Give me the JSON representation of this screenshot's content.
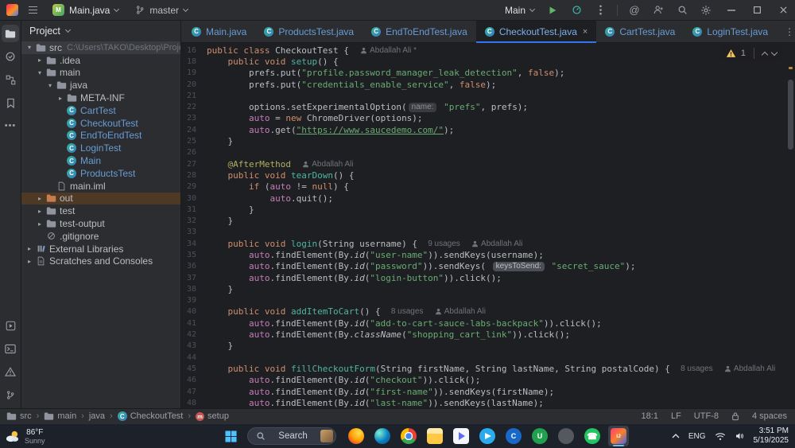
{
  "colors": {
    "accent_blue": "#3574f0",
    "keyword_orange": "#cf8e6d",
    "string_green": "#6aab73",
    "method_teal": "#4fb6a2",
    "field_purple": "#c77dbb",
    "annotation_yellow": "#b3ae60",
    "modified_blue": "#6a9cd4",
    "warning_yellow": "#f2c55c",
    "excluded_bg": "#4e3a24",
    "selection_bg": "#393b40"
  },
  "titlebar": {
    "project": "Main.java",
    "branch": "master",
    "run_config": "Main"
  },
  "project_panel": {
    "title": "Project",
    "tree": [
      {
        "label": "src",
        "path": "C:\\Users\\TAKO\\Desktop\\Project\\Pro...",
        "indent": 0,
        "chevron": "down",
        "icon": "folder",
        "state": "selected"
      },
      {
        "label": ".idea",
        "indent": 1,
        "chevron": "right",
        "icon": "folder"
      },
      {
        "label": "main",
        "indent": 1,
        "chevron": "down",
        "icon": "folder"
      },
      {
        "label": "java",
        "indent": 2,
        "chevron": "down",
        "icon": "folder"
      },
      {
        "label": "META-INF",
        "indent": 3,
        "chevron": "right",
        "icon": "folder"
      },
      {
        "label": "CartTest",
        "indent": 3,
        "icon": "class",
        "modified": true
      },
      {
        "label": "CheckoutTest",
        "indent": 3,
        "icon": "class",
        "modified": true
      },
      {
        "label": "EndToEndTest",
        "indent": 3,
        "icon": "class",
        "modified": true
      },
      {
        "label": "LoginTest",
        "indent": 3,
        "icon": "class",
        "modified": true
      },
      {
        "label": "Main",
        "indent": 3,
        "icon": "class",
        "modified": true
      },
      {
        "label": "ProductsTest",
        "indent": 3,
        "icon": "class",
        "modified": true
      },
      {
        "label": "main.iml",
        "indent": 2,
        "icon": "file"
      },
      {
        "label": "out",
        "indent": 1,
        "chevron": "right",
        "icon": "folder-excluded",
        "state": "excluded"
      },
      {
        "label": "test",
        "indent": 1,
        "chevron": "right",
        "icon": "folder"
      },
      {
        "label": "test-output",
        "indent": 1,
        "chevron": "right",
        "icon": "folder"
      },
      {
        "label": ".gitignore",
        "indent": 1,
        "icon": "ignored"
      },
      {
        "label": "External Libraries",
        "indent": 0,
        "chevron": "right",
        "icon": "library"
      },
      {
        "label": "Scratches and Consoles",
        "indent": 0,
        "chevron": "right",
        "icon": "scratch"
      }
    ]
  },
  "tabs": [
    {
      "label": "Main.java"
    },
    {
      "label": "ProductsTest.java"
    },
    {
      "label": "EndToEndTest.java"
    },
    {
      "label": "CheckoutTest.java",
      "active": true
    },
    {
      "label": "CartTest.java"
    },
    {
      "label": "LoginTest.java"
    }
  ],
  "editor": {
    "inspection": {
      "warning_count": "1"
    },
    "lines": [
      {
        "n": "16",
        "t": [
          [
            "public",
            "k"
          ],
          [
            " ",
            "d"
          ],
          [
            "class",
            "k"
          ],
          [
            " CheckoutTest {  ",
            "d"
          ],
          [
            "Abdallah Ali *",
            "au"
          ]
        ]
      },
      {
        "n": "18",
        "t": [
          [
            "    ",
            "d"
          ],
          [
            "public",
            "k"
          ],
          [
            " ",
            "d"
          ],
          [
            "void",
            "k"
          ],
          [
            " ",
            "d"
          ],
          [
            "setup",
            "f"
          ],
          [
            "() {",
            "d"
          ]
        ]
      },
      {
        "n": "19",
        "t": [
          [
            "        prefs.put(",
            "d"
          ],
          [
            "\"profile.password_manager_leak_detection\"",
            "s"
          ],
          [
            ", ",
            "d"
          ],
          [
            "false",
            "k"
          ],
          [
            ");",
            "d"
          ]
        ]
      },
      {
        "n": "20",
        "t": [
          [
            "        prefs.put(",
            "d"
          ],
          [
            "\"credentials_enable_service\"",
            "s"
          ],
          [
            ", ",
            "d"
          ],
          [
            "false",
            "k"
          ],
          [
            ");",
            "d"
          ]
        ]
      },
      {
        "n": "21",
        "t": []
      },
      {
        "n": "22",
        "t": [
          [
            "        options.setExperimentalOption(",
            "d"
          ],
          [
            "name:",
            "chip"
          ],
          [
            " ",
            "d"
          ],
          [
            "\"prefs\"",
            "s"
          ],
          [
            ", prefs);",
            "d"
          ]
        ]
      },
      {
        "n": "23",
        "t": [
          [
            "        ",
            "d"
          ],
          [
            "auto",
            "fd"
          ],
          [
            " = ",
            "d"
          ],
          [
            "new",
            "k"
          ],
          [
            " ChromeDriver(options);",
            "d"
          ]
        ]
      },
      {
        "n": "24",
        "t": [
          [
            "        ",
            "d"
          ],
          [
            "auto",
            "fd"
          ],
          [
            ".get(",
            "d"
          ],
          [
            "\"https://www.saucedemo.com/\"",
            "su"
          ],
          [
            ");",
            "d"
          ]
        ]
      },
      {
        "n": "25",
        "t": [
          [
            "    }",
            "d"
          ]
        ]
      },
      {
        "n": "26",
        "t": []
      },
      {
        "n": "27",
        "t": [
          [
            "    ",
            "d"
          ],
          [
            "@AfterMethod",
            "a"
          ],
          [
            "  ",
            "d"
          ],
          [
            "Abdallah Ali",
            "au"
          ]
        ]
      },
      {
        "n": "28",
        "t": [
          [
            "    ",
            "d"
          ],
          [
            "public",
            "k"
          ],
          [
            " ",
            "d"
          ],
          [
            "void",
            "k"
          ],
          [
            " ",
            "d"
          ],
          [
            "tearDown",
            "f"
          ],
          [
            "() {",
            "d"
          ]
        ]
      },
      {
        "n": "29",
        "t": [
          [
            "        ",
            "d"
          ],
          [
            "if",
            "k"
          ],
          [
            " (",
            "d"
          ],
          [
            "auto",
            "fd"
          ],
          [
            " != ",
            "d"
          ],
          [
            "null",
            "k"
          ],
          [
            ") {",
            "d"
          ]
        ]
      },
      {
        "n": "30",
        "t": [
          [
            "            ",
            "d"
          ],
          [
            "auto",
            "fd"
          ],
          [
            ".quit();",
            "d"
          ]
        ]
      },
      {
        "n": "31",
        "t": [
          [
            "        }",
            "d"
          ]
        ]
      },
      {
        "n": "32",
        "t": [
          [
            "    }",
            "d"
          ]
        ]
      },
      {
        "n": "33",
        "t": []
      },
      {
        "n": "34",
        "t": [
          [
            "    ",
            "d"
          ],
          [
            "public",
            "k"
          ],
          [
            " ",
            "d"
          ],
          [
            "void",
            "k"
          ],
          [
            " ",
            "d"
          ],
          [
            "login",
            "f"
          ],
          [
            "(String username) {  ",
            "d"
          ],
          [
            "9 usages",
            "m"
          ],
          [
            "  ",
            "d"
          ],
          [
            "Abdallah Ali",
            "au"
          ]
        ]
      },
      {
        "n": "35",
        "t": [
          [
            "        ",
            "d"
          ],
          [
            "auto",
            "fd"
          ],
          [
            ".findElement(By.",
            "d"
          ],
          [
            "id",
            "it"
          ],
          [
            "(",
            "d"
          ],
          [
            "\"user-name\"",
            "s"
          ],
          [
            ")).sendKeys(username);",
            "d"
          ]
        ]
      },
      {
        "n": "36",
        "t": [
          [
            "        ",
            "d"
          ],
          [
            "auto",
            "fd"
          ],
          [
            ".findElement(By.",
            "d"
          ],
          [
            "id",
            "it"
          ],
          [
            "(",
            "d"
          ],
          [
            "\"password\"",
            "s"
          ],
          [
            ")).sendKeys( ",
            "d"
          ],
          [
            "keysToSend:",
            "chip2"
          ],
          [
            " ",
            "d"
          ],
          [
            "\"secret_sauce\"",
            "s"
          ],
          [
            ");",
            "d"
          ]
        ]
      },
      {
        "n": "37",
        "t": [
          [
            "        ",
            "d"
          ],
          [
            "auto",
            "fd"
          ],
          [
            ".findElement(By.",
            "d"
          ],
          [
            "id",
            "it"
          ],
          [
            "(",
            "d"
          ],
          [
            "\"login-button\"",
            "s"
          ],
          [
            ")).click();",
            "d"
          ]
        ]
      },
      {
        "n": "38",
        "t": [
          [
            "    }",
            "d"
          ]
        ]
      },
      {
        "n": "39",
        "t": []
      },
      {
        "n": "40",
        "t": [
          [
            "    ",
            "d"
          ],
          [
            "public",
            "k"
          ],
          [
            " ",
            "d"
          ],
          [
            "void",
            "k"
          ],
          [
            " ",
            "d"
          ],
          [
            "addItemToCart",
            "f"
          ],
          [
            "() {  ",
            "d"
          ],
          [
            "8 usages",
            "m"
          ],
          [
            "  ",
            "d"
          ],
          [
            "Abdallah Ali",
            "au"
          ]
        ]
      },
      {
        "n": "41",
        "t": [
          [
            "        ",
            "d"
          ],
          [
            "auto",
            "fd"
          ],
          [
            ".findElement(By.",
            "d"
          ],
          [
            "id",
            "it"
          ],
          [
            "(",
            "d"
          ],
          [
            "\"add-to-cart-sauce-labs-backpack\"",
            "s"
          ],
          [
            ")).click();",
            "d"
          ]
        ]
      },
      {
        "n": "42",
        "t": [
          [
            "        ",
            "d"
          ],
          [
            "auto",
            "fd"
          ],
          [
            ".findElement(By.",
            "d"
          ],
          [
            "className",
            "it"
          ],
          [
            "(",
            "d"
          ],
          [
            "\"shopping_cart_link\"",
            "s"
          ],
          [
            ")).click();",
            "d"
          ]
        ]
      },
      {
        "n": "43",
        "t": [
          [
            "    }",
            "d"
          ]
        ]
      },
      {
        "n": "44",
        "t": []
      },
      {
        "n": "45",
        "t": [
          [
            "    ",
            "d"
          ],
          [
            "public",
            "k"
          ],
          [
            " ",
            "d"
          ],
          [
            "void",
            "k"
          ],
          [
            " ",
            "d"
          ],
          [
            "fillCheckoutForm",
            "f"
          ],
          [
            "(String firstName, String lastName, String postalCode) {  ",
            "d"
          ],
          [
            "8 usages",
            "m"
          ],
          [
            "  ",
            "d"
          ],
          [
            "Abdallah Ali",
            "au"
          ]
        ]
      },
      {
        "n": "46",
        "t": [
          [
            "        ",
            "d"
          ],
          [
            "auto",
            "fd"
          ],
          [
            ".findElement(By.",
            "d"
          ],
          [
            "id",
            "it"
          ],
          [
            "(",
            "d"
          ],
          [
            "\"checkout\"",
            "s"
          ],
          [
            ")).click();",
            "d"
          ]
        ]
      },
      {
        "n": "47",
        "t": [
          [
            "        ",
            "d"
          ],
          [
            "auto",
            "fd"
          ],
          [
            ".findElement(By.",
            "d"
          ],
          [
            "id",
            "it"
          ],
          [
            "(",
            "d"
          ],
          [
            "\"first-name\"",
            "s"
          ],
          [
            ")).sendKeys(firstName);",
            "d"
          ]
        ]
      },
      {
        "n": "48",
        "t": [
          [
            "        ",
            "d"
          ],
          [
            "auto",
            "fd"
          ],
          [
            ".findElement(By.",
            "d"
          ],
          [
            "id",
            "it"
          ],
          [
            "(",
            "d"
          ],
          [
            "\"last-name\"",
            "s"
          ],
          [
            ")).sendKeys(lastName);",
            "d"
          ]
        ]
      }
    ]
  },
  "breadcrumbs": [
    {
      "label": "src",
      "icon": "folder"
    },
    {
      "label": "main",
      "icon": "folder"
    },
    {
      "label": "java",
      "icon": ""
    },
    {
      "label": "CheckoutTest",
      "icon": "class"
    },
    {
      "label": "setup",
      "icon": "method"
    }
  ],
  "statusbar": {
    "caret": "18:1",
    "line_separator": "LF",
    "encoding": "UTF-8",
    "indent": "4 spaces"
  },
  "taskbar": {
    "weather": {
      "temp": "86°F",
      "condition": "Sunny"
    },
    "search_label": "Search",
    "apps": [
      {
        "id": "firefox"
      },
      {
        "id": "edge"
      },
      {
        "id": "chrome"
      },
      {
        "id": "explorer"
      },
      {
        "id": "media-player"
      },
      {
        "id": "telegram"
      },
      {
        "id": "c-app"
      },
      {
        "id": "u-app"
      },
      {
        "id": "gimp"
      },
      {
        "id": "whatsapp"
      },
      {
        "id": "intellij",
        "active": true
      }
    ],
    "tray": {
      "lang": "ENG",
      "time": "3:51 PM",
      "date": "5/19/2025"
    }
  }
}
